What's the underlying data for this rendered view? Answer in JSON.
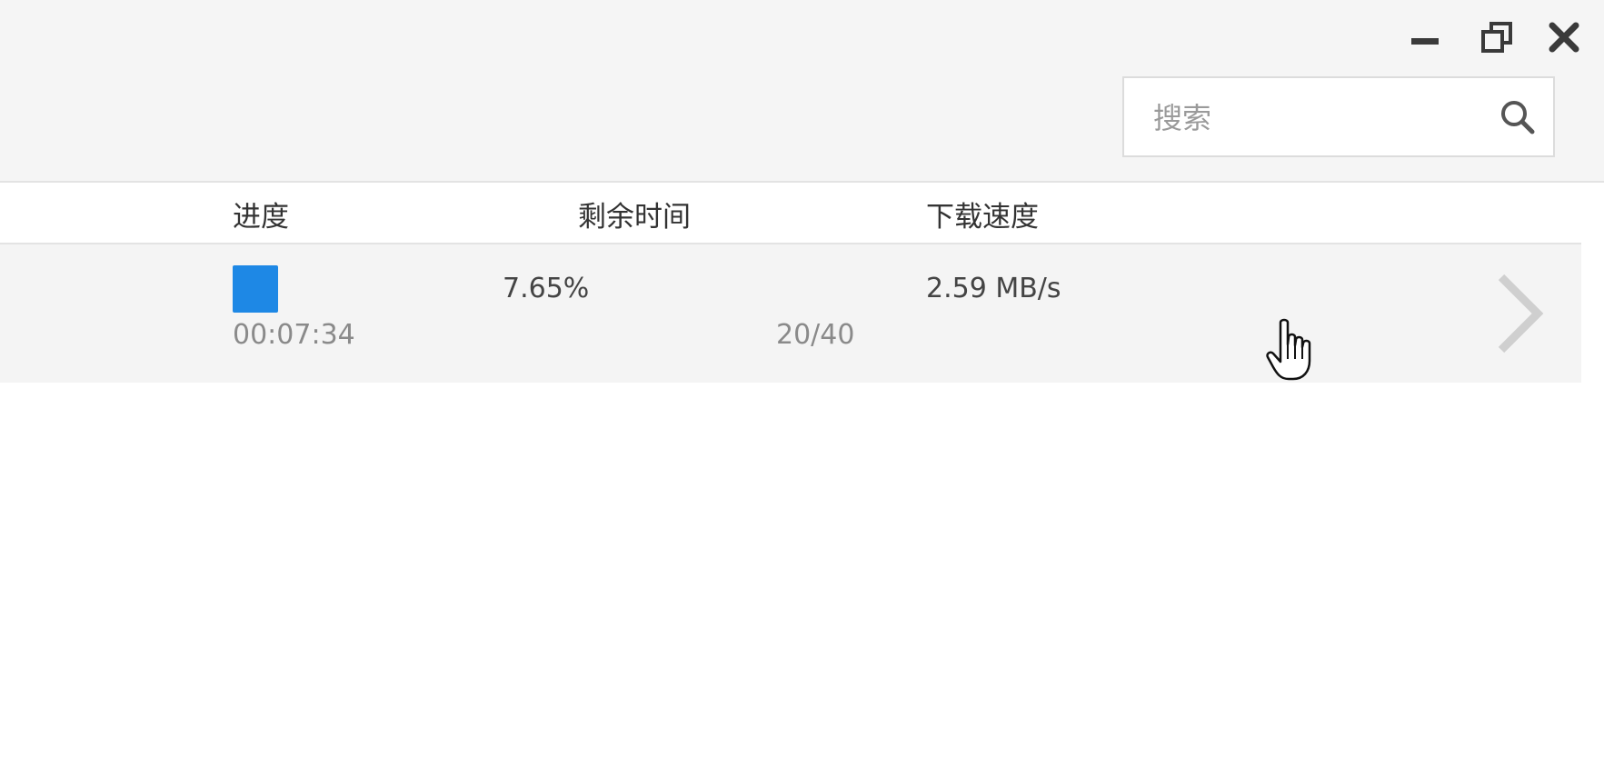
{
  "window_controls": {
    "minimize_icon": "minimize-icon",
    "restore_icon": "restore-icon",
    "close_icon": "close-icon"
  },
  "search": {
    "placeholder": "搜索",
    "value": "",
    "icon": "search-icon"
  },
  "table": {
    "columns": [
      "进度",
      "剩余时间",
      "下载速度"
    ],
    "rows": [
      {
        "progress_fraction": 0.0765,
        "percent": "7.65%",
        "elapsed": "00:07:34",
        "pieces": "20/40",
        "speed": "2.59 MB/s",
        "expand_icon": "chevron-right-icon"
      }
    ]
  },
  "colors": {
    "accent": "#1e88e5",
    "toolbar_bg": "#f5f5f5",
    "row_bg": "#f4f4f4"
  }
}
